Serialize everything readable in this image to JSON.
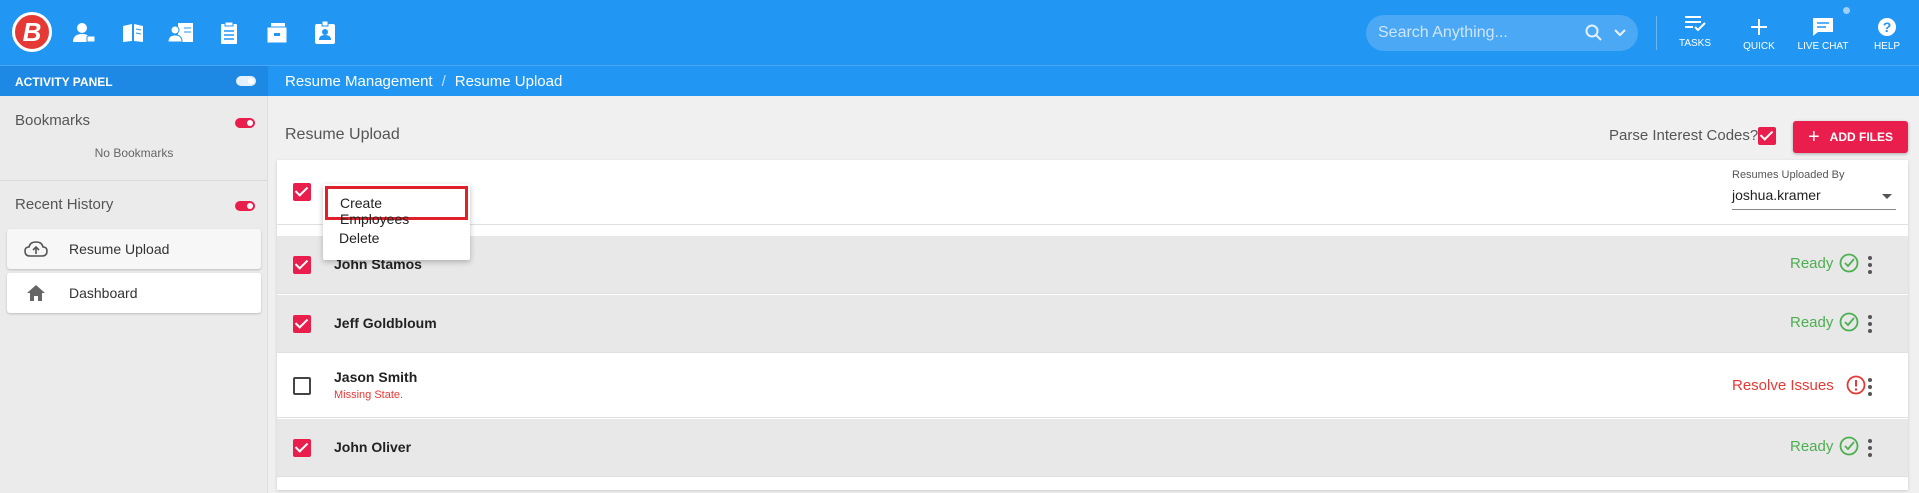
{
  "colors": {
    "primary": "#2196f3",
    "accent": "#e91e4c",
    "ready": "#4caf50",
    "error": "#e53935"
  },
  "topbar": {
    "logo_text": "B",
    "nav_icons": [
      "employee-icon",
      "book-icon",
      "people-card-icon",
      "clipboard-icon",
      "folder-box-icon",
      "badge-icon"
    ],
    "search_placeholder": "Search Anything...",
    "actions": [
      {
        "label": "TASKS",
        "icon": "tasks-icon"
      },
      {
        "label": "QUICK",
        "icon": "plus-icon"
      },
      {
        "label": "LIVE CHAT",
        "icon": "chat-icon"
      },
      {
        "label": "HELP",
        "icon": "help-icon"
      }
    ]
  },
  "subbar": {
    "activity_panel_label": "ACTIVITY PANEL",
    "breadcrumb": [
      "Resume Management",
      "Resume Upload"
    ]
  },
  "sidebar": {
    "bookmarks_label": "Bookmarks",
    "no_bookmarks": "No Bookmarks",
    "recent_label": "Recent History",
    "recent_items": [
      {
        "label": "Resume Upload",
        "icon": "cloud-upload-icon"
      },
      {
        "label": "Dashboard",
        "icon": "home-icon"
      }
    ]
  },
  "main": {
    "title": "Resume Upload",
    "parse_label": "Parse Interest Codes?",
    "parse_checked": true,
    "add_files_label": "ADD FILES",
    "uploaded_by_label": "Resumes Uploaded By",
    "uploaded_by_value": "joshua.kramer",
    "menu": [
      "Create Employees",
      "Delete"
    ],
    "rows": [
      {
        "name": "John Stamos",
        "checked": true,
        "status": "Ready",
        "issue": ""
      },
      {
        "name": "Jeff Goldbloum",
        "checked": true,
        "status": "Ready",
        "issue": ""
      },
      {
        "name": "Jason Smith",
        "checked": false,
        "status": "Resolve Issues",
        "issue": "Missing State."
      },
      {
        "name": "John Oliver",
        "checked": true,
        "status": "Ready",
        "issue": ""
      }
    ]
  }
}
